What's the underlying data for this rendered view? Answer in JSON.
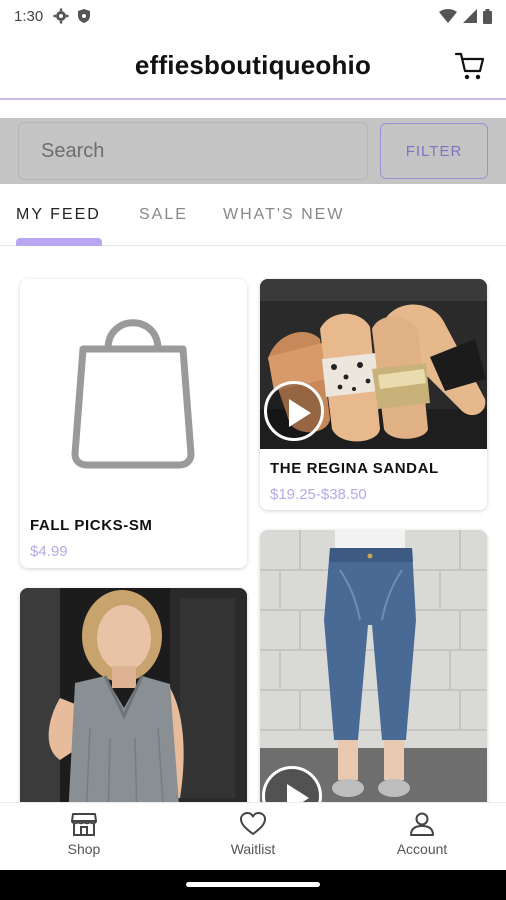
{
  "status_bar": {
    "time": "1:30"
  },
  "header": {
    "title": "effiesboutiqueohio"
  },
  "search": {
    "placeholder": "Search",
    "filter_label": "FILTER"
  },
  "tabs": [
    {
      "label": "MY FEED",
      "active": true
    },
    {
      "label": "SALE",
      "active": false
    },
    {
      "label": "WHAT'S NEW",
      "active": false
    }
  ],
  "products": [
    {
      "name": "FALL PICKS-SM",
      "price": "$4.99"
    },
    {
      "name": "THE REGINA SANDAL",
      "price": "$19.25-$38.50"
    }
  ],
  "bottom_nav": [
    {
      "label": "Shop",
      "icon": "shop-icon"
    },
    {
      "label": "Waitlist",
      "icon": "heart-icon"
    },
    {
      "label": "Account",
      "icon": "account-icon"
    }
  ],
  "colors": {
    "accent": "#b8a6f0",
    "price": "#b7a8ea",
    "search_bar": "#c4c4c4"
  }
}
